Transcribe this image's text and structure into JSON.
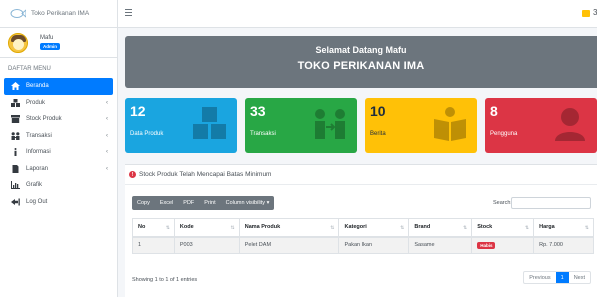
{
  "brand": {
    "text": "Toko Perikanan IMA"
  },
  "user": {
    "name": "Mafu",
    "role_badge": "Admin"
  },
  "sidebar": {
    "header": "DAFTAR MENU",
    "items": [
      {
        "label": "Beranda",
        "icon": "home-icon",
        "active": true,
        "chevron": ""
      },
      {
        "label": "Produk",
        "icon": "boxes-icon",
        "active": false,
        "chevron": "‹"
      },
      {
        "label": "Stock Produk",
        "icon": "archive-icon",
        "active": false,
        "chevron": "‹"
      },
      {
        "label": "Transaksi",
        "icon": "people-icon",
        "active": false,
        "chevron": "‹"
      },
      {
        "label": "Informasi",
        "icon": "info-icon",
        "active": false,
        "chevron": "‹"
      },
      {
        "label": "Laporan",
        "icon": "file-icon",
        "active": false,
        "chevron": "‹"
      },
      {
        "label": "Grafik",
        "icon": "chart-icon",
        "active": false,
        "chevron": ""
      },
      {
        "label": "Log Out",
        "icon": "logout-icon",
        "active": false,
        "chevron": ""
      }
    ]
  },
  "navbar": {
    "menu_icon": "hamburger-icon",
    "right_text": "3"
  },
  "banner": {
    "line1": "Selamat Datang Mafu",
    "line2": "TOKO PERIKANAN IMA"
  },
  "boxes": [
    {
      "number": "12",
      "label": "Data Produk",
      "color": "#1aa5e0",
      "icon": "boxes-icon"
    },
    {
      "number": "33",
      "label": "Transaksi",
      "color": "#28a745",
      "icon": "exchange-icon"
    },
    {
      "number": "10",
      "label": "Berita",
      "color": "#ffc107",
      "icon": "book-icon"
    },
    {
      "number": "8",
      "label": "Pengguna",
      "color": "#dc3545",
      "icon": "user-icon"
    }
  ],
  "card": {
    "alert_text": "Stock Produk Telah Mencapai Batas Minimum"
  },
  "toolbar": {
    "buttons": [
      "Copy",
      "Excel",
      "PDF",
      "Print",
      "Column visibility ▾"
    ]
  },
  "search": {
    "label": "Search:",
    "value": ""
  },
  "table": {
    "headers": [
      "No",
      "Kode",
      "Nama Produk",
      "Kategori",
      "Brand",
      "Stock",
      "Harga"
    ],
    "rows": [
      {
        "no": "1",
        "kode": "P003",
        "nama": "Pelet DAM",
        "kategori": "Pakan Ikan",
        "brand": "Sasame",
        "stock": "Habis",
        "harga": "Rp. 7.000"
      }
    ]
  },
  "footer": {
    "info": "Showing 1 to 1 of 1 entries"
  },
  "pagination": {
    "previous": "Previous",
    "current": "1",
    "next": "Next"
  }
}
